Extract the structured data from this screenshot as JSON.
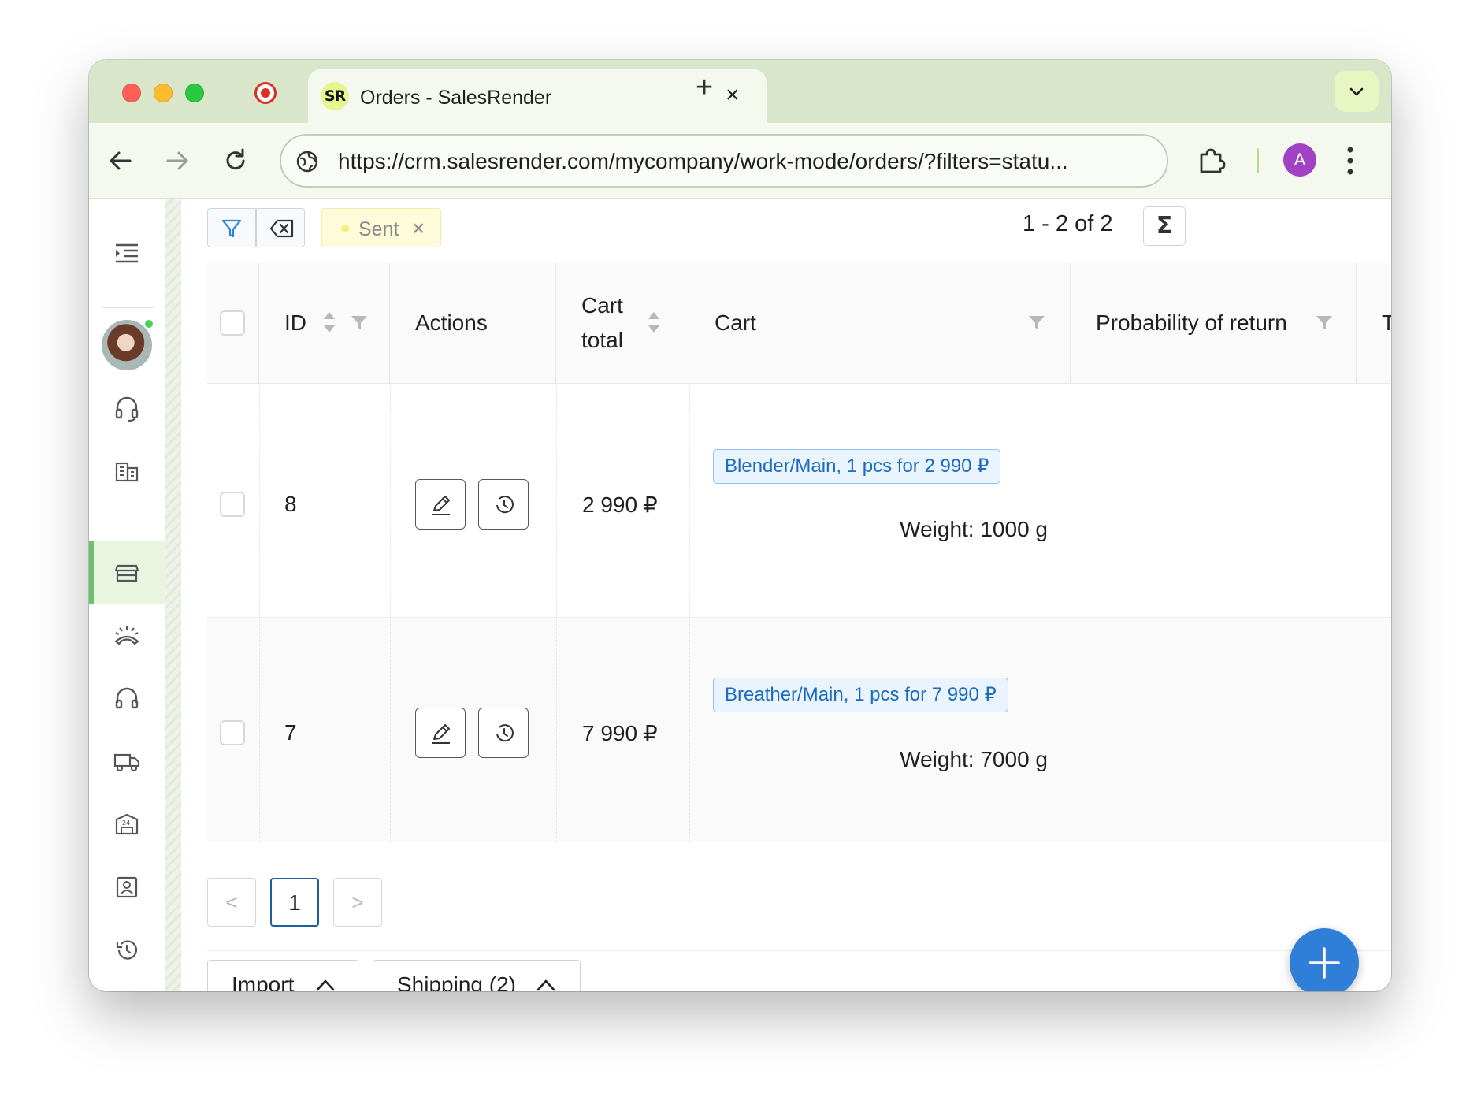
{
  "browser": {
    "tab_title": "Orders - SalesRender",
    "favicon_text": "SR",
    "url": "https://crm.salesrender.com/mycompany/work-mode/orders/?filters=statu...",
    "profile_initial": "A"
  },
  "sidebar": {
    "items": [
      {
        "name": "menu-toggle",
        "icon": "indent-list-icon"
      },
      {
        "name": "avatar",
        "icon": "user-photo"
      },
      {
        "name": "support",
        "icon": "headphones-icon"
      },
      {
        "name": "company",
        "icon": "building-icon"
      },
      {
        "name": "orders",
        "icon": "store-icon",
        "active": true
      },
      {
        "name": "dialer",
        "icon": "phone-hangup-icon"
      },
      {
        "name": "operators",
        "icon": "headset-icon"
      },
      {
        "name": "delivery",
        "icon": "truck-icon"
      },
      {
        "name": "warehouse",
        "icon": "warehouse-24-icon"
      },
      {
        "name": "contacts",
        "icon": "contact-card-icon"
      },
      {
        "name": "history",
        "icon": "history-icon"
      }
    ]
  },
  "filters": {
    "chip_label": "Sent",
    "counter": "1 - 2 of 2",
    "sum_symbol": "Σ"
  },
  "table": {
    "columns": {
      "id": "ID",
      "actions": "Actions",
      "cart_total_line1": "Cart",
      "cart_total_line2": "total",
      "cart": "Cart",
      "probability": "Probability of return",
      "next_col_partial": "T"
    },
    "rows": [
      {
        "id": "8",
        "cart_total": "2 990 ₽",
        "cart_tag": "Blender/Main, 1 pcs for 2 990 ₽",
        "weight": "Weight: 1000 g"
      },
      {
        "id": "7",
        "cart_total": "7 990 ₽",
        "cart_tag": "Breather/Main, 1 pcs for 7 990 ₽",
        "weight": "Weight: 7000 g"
      }
    ]
  },
  "pagination": {
    "prev": "<",
    "current": "1",
    "next": ">"
  },
  "bottom_bar": {
    "import_label": "Import",
    "shipping_label": "Shipping (2)"
  },
  "colors": {
    "accent_blue": "#2f7fd8",
    "active_green": "#6bc26b",
    "tag_blue": "#1b6bbf",
    "chip_yellow": "#fdfbd9"
  }
}
